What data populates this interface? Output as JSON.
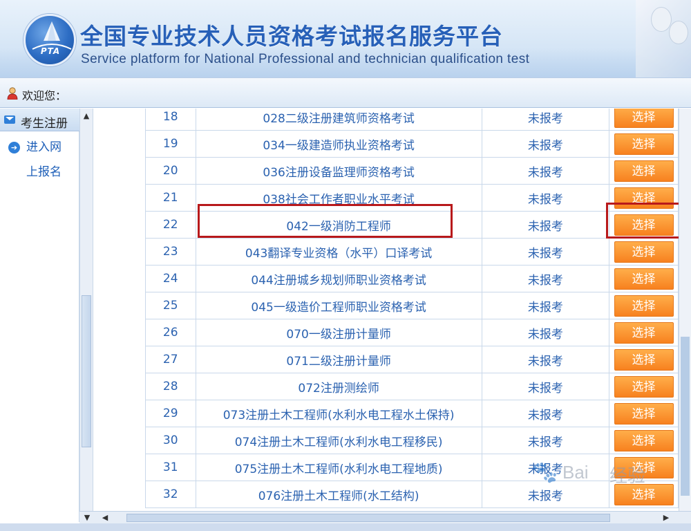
{
  "header": {
    "logo_text": "PTA",
    "title_cn": "全国专业技术人员资格考试报名服务平台",
    "title_en": "Service platform for National Professional and technician qualification test"
  },
  "welcome": {
    "label": "欢迎您："
  },
  "sidebar": {
    "section": "考生注册",
    "link_line1": "进入网",
    "link_line2": "上报名"
  },
  "table": {
    "rows": [
      {
        "num": "18",
        "name": "028二级注册建筑师资格考试",
        "status": "未报考",
        "action": "选择"
      },
      {
        "num": "19",
        "name": "034一级建造师执业资格考试",
        "status": "未报考",
        "action": "选择"
      },
      {
        "num": "20",
        "name": "036注册设备监理师资格考试",
        "status": "未报考",
        "action": "选择"
      },
      {
        "num": "21",
        "name": "038社会工作者职业水平考试",
        "status": "未报考",
        "action": "选择"
      },
      {
        "num": "22",
        "name": "042一级消防工程师",
        "status": "未报考",
        "action": "选择"
      },
      {
        "num": "23",
        "name": "043翻译专业资格（水平）口译考试",
        "status": "未报考",
        "action": "选择"
      },
      {
        "num": "24",
        "name": "044注册城乡规划师职业资格考试",
        "status": "未报考",
        "action": "选择"
      },
      {
        "num": "25",
        "name": "045一级造价工程师职业资格考试",
        "status": "未报考",
        "action": "选择"
      },
      {
        "num": "26",
        "name": "070一级注册计量师",
        "status": "未报考",
        "action": "选择"
      },
      {
        "num": "27",
        "name": "071二级注册计量师",
        "status": "未报考",
        "action": "选择"
      },
      {
        "num": "28",
        "name": "072注册测绘师",
        "status": "未报考",
        "action": "选择"
      },
      {
        "num": "29",
        "name": "073注册土木工程师(水利水电工程水土保持)",
        "status": "未报考",
        "action": "选择"
      },
      {
        "num": "30",
        "name": "074注册土木工程师(水利水电工程移民)",
        "status": "未报考",
        "action": "选择"
      },
      {
        "num": "31",
        "name": "075注册土木工程师(水利水电工程地质)",
        "status": "未报考",
        "action": "选择"
      },
      {
        "num": "32",
        "name": "076注册土木工程师(水工结构)",
        "status": "未报考",
        "action": "选择"
      }
    ]
  },
  "watermark": {
    "t1": "Bai",
    "t2": "经验"
  },
  "colors": {
    "button": "#f7811f",
    "highlight": "#b8191b",
    "link": "#2b62b0",
    "title": "#2760b8"
  }
}
